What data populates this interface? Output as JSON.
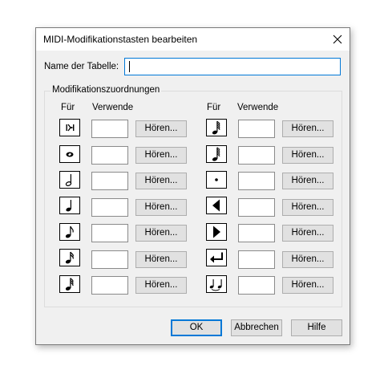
{
  "dialog": {
    "title": "MIDI-Modifikationstasten bearbeiten",
    "name_label": "Name der Tabelle:",
    "name_value": "",
    "group_title": "Modifikationszuordnungen",
    "col_for": "Für",
    "col_use": "Verwende"
  },
  "left_rows": [
    {
      "icon": "accent-staccato-icon",
      "value": "",
      "listen_label": "Hören..."
    },
    {
      "icon": "whole-note-icon",
      "value": "",
      "listen_label": "Hören..."
    },
    {
      "icon": "half-note-icon",
      "value": "",
      "listen_label": "Hören..."
    },
    {
      "icon": "quarter-note-icon",
      "value": "",
      "listen_label": "Hören..."
    },
    {
      "icon": "eighth-note-icon",
      "value": "",
      "listen_label": "Hören..."
    },
    {
      "icon": "sixteenth-note-icon",
      "value": "",
      "listen_label": "Hören..."
    },
    {
      "icon": "thirty-second-note-icon",
      "value": "",
      "listen_label": "Hören..."
    }
  ],
  "right_rows": [
    {
      "icon": "sixty-fourth-note-icon",
      "value": "",
      "listen_label": "Hören..."
    },
    {
      "icon": "hundred-twenty-eighth-note-icon",
      "value": "",
      "listen_label": "Hören..."
    },
    {
      "icon": "dot-icon",
      "value": "",
      "listen_label": "Hören..."
    },
    {
      "icon": "triangle-left-icon",
      "value": "",
      "listen_label": "Hören..."
    },
    {
      "icon": "triangle-right-icon",
      "value": "",
      "listen_label": "Hören..."
    },
    {
      "icon": "return-arrow-icon",
      "value": "",
      "listen_label": "Hören..."
    },
    {
      "icon": "tie-note-icon",
      "value": "",
      "listen_label": "Hören..."
    }
  ],
  "buttons": {
    "ok": "OK",
    "cancel": "Abbrechen",
    "help": "Hilfe"
  }
}
